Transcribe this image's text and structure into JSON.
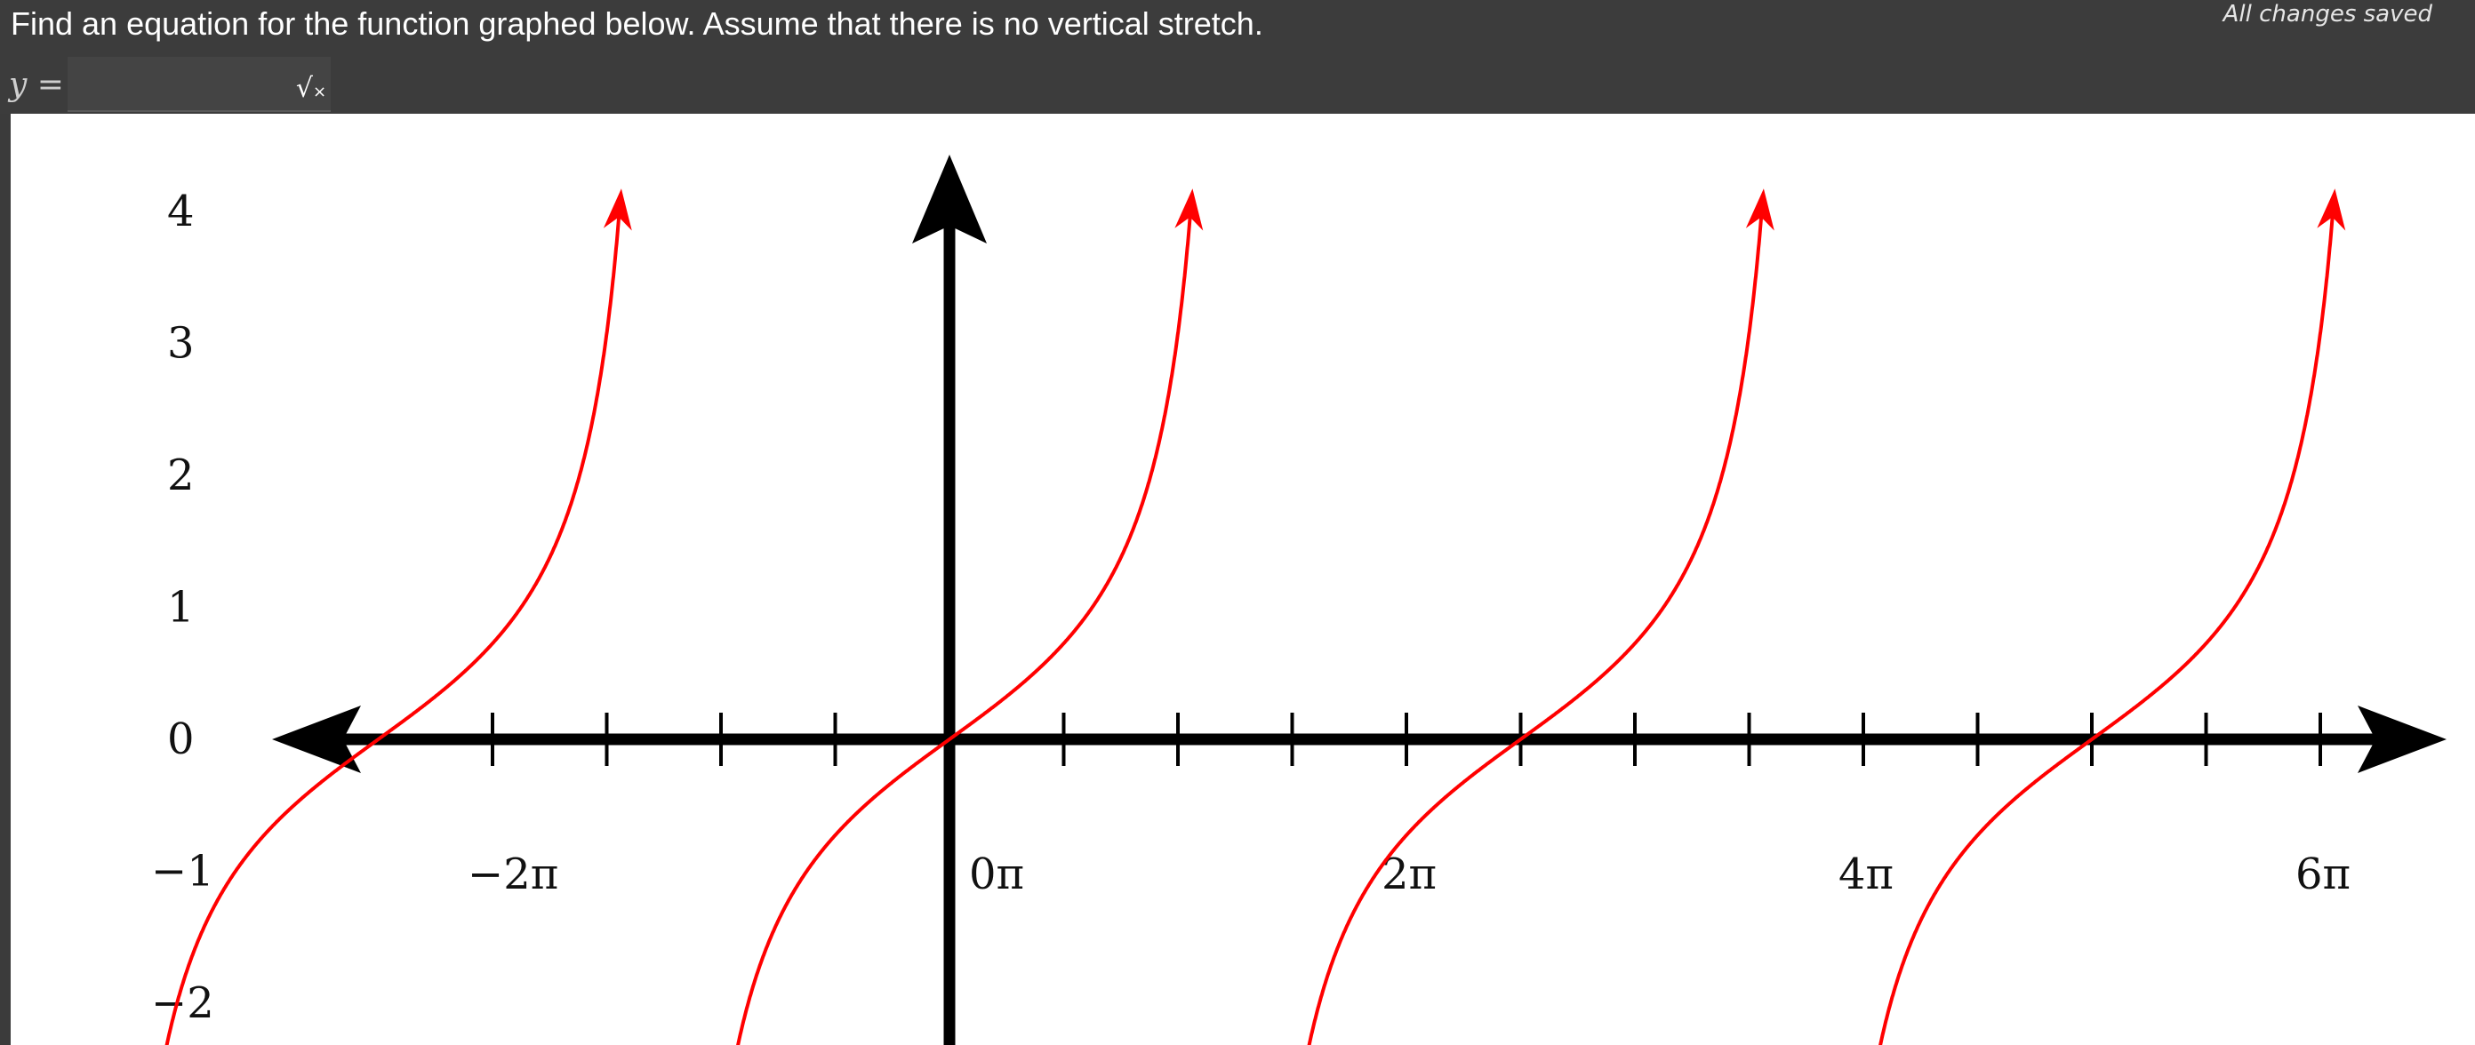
{
  "question": {
    "text": "Find an equation for the function graphed below. Assume that there is no vertical stretch."
  },
  "status": {
    "saved_text": "All changes saved"
  },
  "answer": {
    "label": "y =",
    "value": "",
    "placeholder": "",
    "math_button": {
      "symbol": "√",
      "sub": "×",
      "icon": "sqrt-icon"
    }
  },
  "chart_data": {
    "type": "line",
    "function_family": "tangent",
    "series": [
      {
        "color": "#ff0000",
        "period_pi": 5,
        "zero_crossings_pi": [
          -5,
          0,
          5,
          10
        ],
        "asymptotes_pi": [
          -7.5,
          -2.5,
          2.5,
          7.5
        ],
        "sample_points_pi": [
          {
            "x": -1,
            "y": -0.73
          },
          {
            "x": 0,
            "y": 0
          },
          {
            "x": 1,
            "y": 0.73
          },
          {
            "x": 2,
            "y": 3.08
          }
        ]
      }
    ],
    "x_axis": {
      "range_pi": [
        -5.5,
        12.8
      ],
      "tick_step_pi": 1,
      "labeled_ticks": [
        {
          "value_pi": -4,
          "label": "−2π"
        },
        {
          "value_pi": 0,
          "label": "0π"
        },
        {
          "value_pi": 4,
          "label": "2π"
        },
        {
          "value_pi": 8,
          "label": "4π"
        },
        {
          "value_pi": 12,
          "label": "6π"
        }
      ]
    },
    "y_axis": {
      "range": [
        -2.1,
        4.4
      ],
      "ticks": [
        4,
        3,
        2,
        1,
        0,
        -1,
        -2
      ]
    },
    "grid": false,
    "axis_color": "#000000"
  }
}
